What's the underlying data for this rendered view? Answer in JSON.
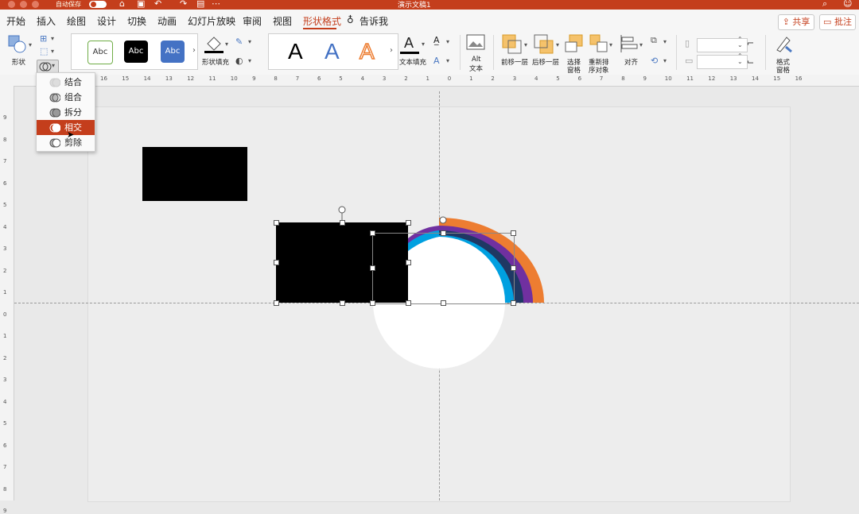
{
  "window": {
    "autosave_label": "自动保存",
    "doc_title": "演示文稿1"
  },
  "menu": {
    "items": [
      "开始",
      "插入",
      "绘图",
      "设计",
      "切换",
      "动画",
      "幻灯片放映",
      "审阅",
      "视图",
      "形状格式",
      "告诉我"
    ],
    "active": "形状格式",
    "share": "共享",
    "comment": "批注"
  },
  "ribbon": {
    "shape_label": "形状",
    "style_samples": [
      "Abc",
      "Abc",
      "Abc"
    ],
    "shape_fill_label": "形状填充",
    "wordart_samples": [
      "A",
      "A",
      "A"
    ],
    "text_fill_label": "文本填充",
    "alt_text_label_1": "Alt",
    "alt_text_label_2": "文本",
    "bring_forward": "前移一层",
    "send_backward": "后移一层",
    "selection_pane_1": "选择",
    "selection_pane_2": "窗格",
    "reorder_1": "重新排",
    "reorder_2": "序对象",
    "align": "对齐",
    "format_pane_1": "格式",
    "format_pane_2": "窗格",
    "colors": {
      "accent": "#c43e1c",
      "style_blue": "#4472c4",
      "wordart_blue": "#4472c4",
      "wordart_orange": "#ed7d31"
    }
  },
  "ruler": {
    "h_numbers": [
      "16",
      "15",
      "14",
      "13",
      "12",
      "11",
      "10",
      "9",
      "8",
      "7",
      "6",
      "5",
      "4",
      "3",
      "2",
      "1",
      "0",
      "1",
      "2",
      "3",
      "4",
      "5",
      "6",
      "7",
      "8",
      "9",
      "10",
      "11",
      "12",
      "13",
      "14",
      "15",
      "16"
    ],
    "v_numbers": [
      "9",
      "8",
      "7",
      "6",
      "5",
      "4",
      "3",
      "2",
      "1",
      "0",
      "1",
      "2",
      "3",
      "4",
      "5",
      "6",
      "7",
      "8",
      "9"
    ]
  },
  "merge_menu": {
    "items": [
      "结合",
      "组合",
      "拆分",
      "相交",
      "剪除"
    ],
    "highlighted": "相交"
  },
  "rainbow_colors": [
    "#ed7d31",
    "#7030a0",
    "#1f3864",
    "#00a0e0"
  ]
}
